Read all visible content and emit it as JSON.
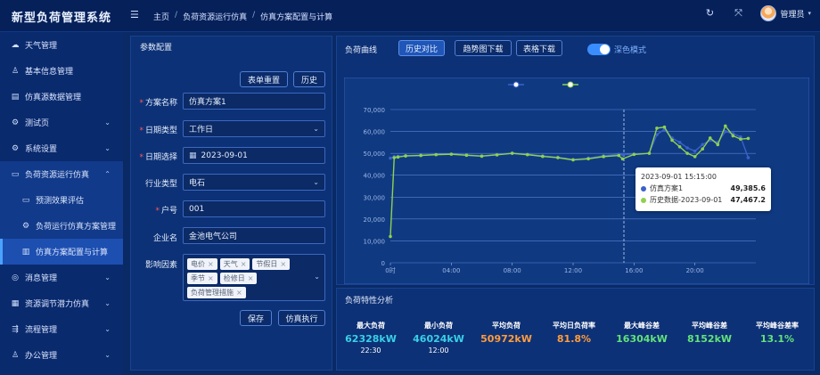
{
  "app": {
    "title": "新型负荷管理系统"
  },
  "breadcrumb": [
    "主页",
    "负荷资源运行仿真",
    "仿真方案配置与计算"
  ],
  "header": {
    "user": "管理员"
  },
  "sidebar": {
    "items": [
      {
        "label": "天气管理",
        "icon": "cloud-icon"
      },
      {
        "label": "基本信息管理",
        "icon": "user-icon"
      },
      {
        "label": "仿真源数据管理",
        "icon": "database-icon"
      },
      {
        "label": "测试页",
        "icon": "gear-icon"
      },
      {
        "label": "系统设置",
        "icon": "gear-icon"
      },
      {
        "label": "负荷资源运行仿真",
        "icon": "monitor-icon"
      },
      {
        "label": "预测效果评估",
        "icon": "monitor-icon"
      },
      {
        "label": "负荷运行仿真方案管理",
        "icon": "gear-icon"
      },
      {
        "label": "仿真方案配置与计算",
        "icon": "bars-icon"
      },
      {
        "label": "消息管理",
        "icon": "message-icon"
      },
      {
        "label": "资源调节潜力仿真",
        "icon": "grid-icon"
      },
      {
        "label": "流程管理",
        "icon": "flow-icon"
      },
      {
        "label": "办公管理",
        "icon": "user-icon"
      }
    ]
  },
  "form": {
    "title": "参数配置",
    "reset_label": "表单重置",
    "history_label": "历史",
    "fields": {
      "scheme_name": {
        "label": "方案名称",
        "value": "仿真方案1"
      },
      "date_type": {
        "label": "日期类型",
        "value": "工作日"
      },
      "date_select": {
        "label": "日期选择",
        "value": "2023-09-01"
      },
      "industry": {
        "label": "行业类型",
        "value": "电石"
      },
      "account": {
        "label": "户号",
        "value": "001"
      },
      "company": {
        "label": "企业名",
        "value": "金池电气公司"
      },
      "factors": {
        "label": "影响因素"
      }
    },
    "tags": [
      "电价",
      "天气",
      "节假日",
      "季节",
      "检修日",
      "负荷管理措施"
    ],
    "save_label": "保存",
    "run_label": "仿真执行"
  },
  "chart_panel": {
    "title": "负荷曲线",
    "btn_history": "历史对比",
    "btn_trend": "趋势图下载",
    "btn_table": "表格下载",
    "dark_mode_label": "深色模式",
    "tooltip": {
      "time": "2023-09-01 15:15:00",
      "rows": [
        {
          "name": "仿真方案1",
          "value": "49,385.6"
        },
        {
          "name": "历史数据-2023-09-01",
          "value": "47,467.2"
        }
      ]
    }
  },
  "chart_data": {
    "type": "line",
    "x_tick_labels": [
      "0时",
      "04:00",
      "08:00",
      "12:00",
      "16:00",
      "20:00"
    ],
    "ylim": [
      0,
      70000
    ],
    "y_tick_labels": [
      "0",
      "10,000",
      "20,000",
      "30,000",
      "40,000",
      "50,000",
      "60,000",
      "70,000"
    ],
    "x_hours": [
      0,
      0.25,
      0.5,
      1,
      2,
      3,
      4,
      5,
      6,
      7,
      8,
      9,
      10,
      11,
      12,
      13,
      14,
      15,
      15.25,
      16,
      17,
      17.5,
      18,
      18.5,
      19,
      19.5,
      20,
      20.5,
      21,
      21.5,
      22,
      22.5,
      23,
      23.5
    ],
    "series": [
      {
        "values": [
          47800,
          48500,
          48600,
          48900,
          49200,
          49500,
          49700,
          49300,
          48800,
          49500,
          50200,
          49600,
          48800,
          48200,
          47200,
          47800,
          48900,
          49600,
          49385.6,
          49700,
          50100,
          58500,
          61000,
          57000,
          55000,
          52500,
          51000,
          54000,
          56000,
          55000,
          60000,
          59000,
          57500,
          48000
        ]
      },
      {
        "values": [
          12000,
          48000,
          48300,
          48800,
          49000,
          49400,
          49600,
          49100,
          48700,
          49300,
          50000,
          49400,
          48600,
          48000,
          47000,
          47500,
          48500,
          49000,
          47467.2,
          49500,
          50000,
          61500,
          62000,
          56000,
          53000,
          50000,
          48500,
          52000,
          57000,
          54000,
          62500,
          58000,
          56500,
          56800
        ]
      }
    ],
    "colors": [
      "#3a62c9",
      "#8fd14f"
    ],
    "grid": true,
    "legend": "top-center"
  },
  "stats": {
    "title": "负荷特性分析",
    "items": [
      {
        "label": "最大负荷",
        "value": "62328kW",
        "sub": "22:30",
        "color": "#39d0e8"
      },
      {
        "label": "最小负荷",
        "value": "46024kW",
        "sub": "12:00",
        "color": "#39d0e8"
      },
      {
        "label": "平均负荷",
        "value": "50972kW",
        "sub": "",
        "color": "#ff9c3d"
      },
      {
        "label": "平均日负荷率",
        "value": "81.8%",
        "sub": "",
        "color": "#ff9c3d"
      },
      {
        "label": "最大峰谷差",
        "value": "16304kW",
        "sub": "",
        "color": "#62e37a"
      },
      {
        "label": "平均峰谷差",
        "value": "8152kW",
        "sub": "",
        "color": "#62e37a"
      },
      {
        "label": "平均峰谷差率",
        "value": "13.1%",
        "sub": "",
        "color": "#62e37a"
      }
    ]
  }
}
